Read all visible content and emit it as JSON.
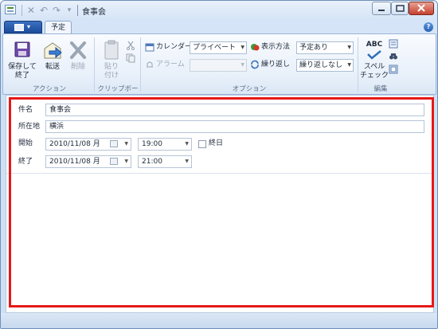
{
  "window": {
    "title": "食事会",
    "min_icon": "minimize-icon",
    "max_icon": "maximize-icon",
    "close_icon": "close-icon"
  },
  "quick_access": {
    "close_glyph": "✕",
    "undo_glyph": "↶",
    "redo_glyph": "↷",
    "customize_glyph": "▾"
  },
  "tabs": {
    "active": "予定"
  },
  "ribbon": {
    "groups": {
      "action": "アクション",
      "clipboard": "クリップボード",
      "options": "オプション",
      "edit": "編集"
    },
    "save_close": [
      "保存して",
      "終了"
    ],
    "forward": "転送",
    "delete": "削除",
    "paste": [
      "貼り",
      "付け"
    ],
    "calendar_label": "カレンダー",
    "calendar_value": "プライベート",
    "alarm_label": "アラーム",
    "alarm_value": "",
    "show_as_label": "表示方法",
    "show_as_value": "予定あり",
    "repeat_label": "繰り返し",
    "repeat_value": "繰り返しなし",
    "spell_check": [
      "スペル",
      "チェック"
    ],
    "spell_abc": "ABC"
  },
  "form": {
    "subject_label": "件名",
    "subject_value": "食事会",
    "location_label": "所在地",
    "location_value": "横浜",
    "start_label": "開始",
    "start_date": "2010/11/08 月",
    "start_time": "19:00",
    "allday_label": "終日",
    "end_label": "終了",
    "end_date": "2010/11/08 月",
    "end_time": "21:00"
  },
  "colors": {
    "highlight": "#e61919",
    "accent": "#1d4c9b"
  }
}
